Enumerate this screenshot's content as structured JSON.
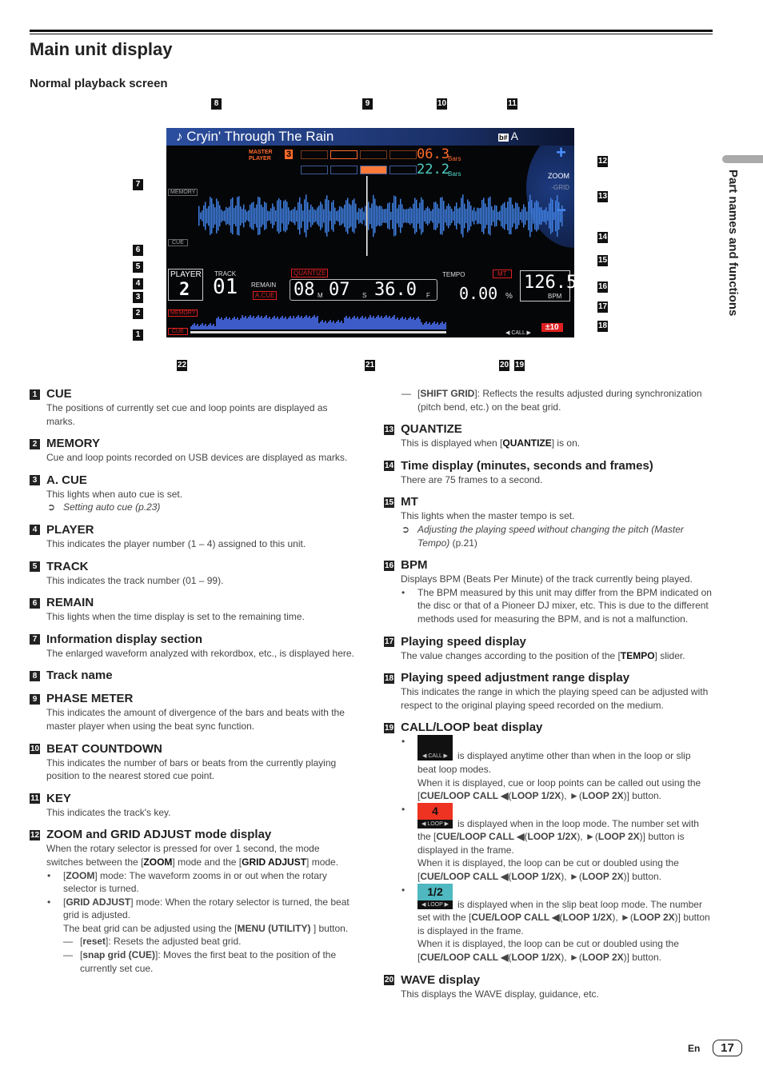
{
  "page": {
    "title": "Main unit display",
    "subtitle": "Normal playback screen",
    "side_tab": "Part names and functions",
    "lang": "En",
    "page_number": "17"
  },
  "figure": {
    "track_title": "♪ Cryin' Through The Rain",
    "key_icon": "b#",
    "key": "A",
    "master_player_label": "MASTER PLAYER",
    "master_player_num": "3",
    "bars_master": "06.3",
    "bars_own": "22.2",
    "bars_unit": "Bars",
    "zoom_label": "ZOOM",
    "grid_label": "-GRID",
    "zoom_plus": "+",
    "zoom_minus": "−",
    "memory_label": "MEMORY",
    "cue_label": "CUE",
    "player_label": "PLAYER",
    "player_num": "2",
    "track_label": "TRACK",
    "track_num": "01",
    "remain_label": "REMAIN",
    "acue_label": "A.CUE",
    "quantize_label": "QUANTIZE",
    "time": {
      "min": "08",
      "m": "M",
      "sec": "07",
      "s": "S",
      "frames": "36.0",
      "f": "F"
    },
    "tempo_label": "TEMPO",
    "mt_label": "MT",
    "tempo_value": "0.00",
    "tempo_unit": "%",
    "bpm_value": "126.5",
    "bpm_label": "BPM",
    "range_value": "±10",
    "call_label": "◀ CALL ▶",
    "callouts": [
      "1",
      "2",
      "3",
      "4",
      "5",
      "6",
      "7",
      "8",
      "9",
      "10",
      "11",
      "12",
      "13",
      "14",
      "15",
      "16",
      "17",
      "18",
      "19",
      "20",
      "21",
      "22"
    ],
    "colors": {
      "waveform": "#3f7fe0",
      "master": "#ff6a2a",
      "own": "#4fd1c5",
      "accent_red": "#e02020"
    }
  },
  "left": [
    {
      "n": "1",
      "h": "CUE",
      "body": [
        [
          [
            "The positions of currently set cue and loop points are displayed as marks.",
            ""
          ]
        ]
      ]
    },
    {
      "n": "2",
      "h": "MEMORY",
      "body": [
        [
          [
            "Cue and loop points recorded on USB devices are displayed as marks.",
            ""
          ]
        ]
      ]
    },
    {
      "n": "3",
      "h": "A. CUE",
      "body": [
        [
          [
            "This lights when auto cue is set.",
            ""
          ]
        ]
      ],
      "items": [
        {
          "mk": "➲",
          "t": [
            [
              "Setting auto cue",
              "i"
            ],
            [
              " (p.23)",
              "i"
            ]
          ]
        }
      ]
    },
    {
      "n": "4",
      "h": "PLAYER",
      "body": [
        [
          [
            "This indicates the player number (1 – 4) assigned to this unit.",
            ""
          ]
        ]
      ]
    },
    {
      "n": "5",
      "h": "TRACK",
      "body": [
        [
          [
            "This indicates the track number (01 – 99).",
            ""
          ]
        ]
      ]
    },
    {
      "n": "6",
      "h": "REMAIN",
      "body": [
        [
          [
            "This lights when the time display is set to the remaining time.",
            ""
          ]
        ]
      ]
    },
    {
      "n": "7",
      "h": "Information display section",
      "body": [
        [
          [
            "The enlarged waveform analyzed with rekordbox, etc., is displayed here.",
            ""
          ]
        ]
      ]
    },
    {
      "n": "8",
      "h": "Track name"
    },
    {
      "n": "9",
      "h": "PHASE METER",
      "body": [
        [
          [
            "This indicates the amount of divergence of the bars and beats with the master player when using the beat sync function.",
            ""
          ]
        ]
      ]
    },
    {
      "n": "10",
      "h": "BEAT COUNTDOWN",
      "body": [
        [
          [
            "This indicates the number of bars or beats from the currently playing position to the nearest stored cue point.",
            ""
          ]
        ]
      ]
    },
    {
      "n": "11",
      "h": "KEY",
      "body": [
        [
          [
            "This indicates the track's key.",
            ""
          ]
        ]
      ]
    },
    {
      "n": "12",
      "h": "ZOOM and GRID ADJUST mode display",
      "body": [
        [
          [
            "When the rotary selector is pressed for over 1 second, the mode switches between the [",
            ""
          ],
          [
            "ZOOM",
            "b"
          ],
          [
            "] mode and the [",
            ""
          ],
          [
            "GRID ADJUST",
            "b"
          ],
          [
            "] mode.",
            ""
          ]
        ]
      ],
      "items": [
        {
          "mk": "•",
          "t": [
            [
              "[",
              ""
            ],
            [
              "ZOOM",
              "b"
            ],
            [
              "] mode: The waveform zooms in or out when the rotary selector is turned.",
              ""
            ]
          ]
        },
        {
          "mk": "•",
          "t": [
            [
              "[",
              ""
            ],
            [
              "GRID ADJUST",
              "b"
            ],
            [
              "] mode: When the rotary selector is turned, the beat grid is adjusted.",
              ""
            ]
          ]
        },
        {
          "mk": "",
          "t": [
            [
              "The beat grid can be adjusted using the [",
              ""
            ],
            [
              "MENU (UTILITY)",
              "b"
            ],
            [
              " ] button.",
              ""
            ]
          ]
        },
        {
          "mk": "—",
          "t": [
            [
              "[",
              ""
            ],
            [
              "reset",
              "b"
            ],
            [
              "]: Resets the adjusted beat grid.",
              ""
            ]
          ]
        },
        {
          "mk": "—",
          "t": [
            [
              "[",
              ""
            ],
            [
              "snap grid (CUE)",
              "b"
            ],
            [
              "]: Moves the first beat to the position of the currently set cue.",
              ""
            ]
          ]
        }
      ]
    }
  ],
  "right": [
    {
      "items": [
        {
          "mk": "—",
          "t": [
            [
              "[",
              ""
            ],
            [
              "SHIFT GRID",
              "b"
            ],
            [
              "]: Reflects the results adjusted during synchronization (pitch bend, etc.) on the beat grid.",
              ""
            ]
          ]
        }
      ]
    },
    {
      "n": "13",
      "h": "QUANTIZE",
      "body": [
        [
          [
            "This is displayed when [",
            ""
          ],
          [
            "QUANTIZE",
            "b"
          ],
          [
            "] is on.",
            ""
          ]
        ]
      ]
    },
    {
      "n": "14",
      "h": "Time display (minutes, seconds and frames)",
      "body": [
        [
          [
            "There are 75 frames to a second.",
            ""
          ]
        ]
      ]
    },
    {
      "n": "15",
      "h": "MT",
      "body": [
        [
          [
            "This lights when the master tempo is set.",
            ""
          ]
        ]
      ],
      "items": [
        {
          "mk": "➲",
          "t": [
            [
              "Adjusting the playing speed without changing the pitch (Master Tempo)",
              "i"
            ],
            [
              " (p.21)",
              ""
            ]
          ]
        }
      ]
    },
    {
      "n": "16",
      "h": "BPM",
      "body": [
        [
          [
            "Displays BPM (Beats Per Minute) of the track currently being played.",
            ""
          ]
        ]
      ],
      "items": [
        {
          "mk": "•",
          "t": [
            [
              "The BPM measured by this unit may differ from the BPM indicated on the disc or that of a Pioneer DJ mixer, etc. This is due to the different methods used for measuring the BPM, and is not a malfunction.",
              ""
            ]
          ]
        }
      ]
    },
    {
      "n": "17",
      "h": "Playing speed display",
      "body": [
        [
          [
            "The value changes according to the position of the [",
            ""
          ],
          [
            "TEMPO",
            "b"
          ],
          [
            "] slider.",
            ""
          ]
        ]
      ]
    },
    {
      "n": "18",
      "h": "Playing speed adjustment range display",
      "body": [
        [
          [
            "This indicates the range in which the playing speed can be adjusted with respect to the original playing speed recorded on the medium.",
            ""
          ]
        ]
      ]
    },
    {
      "n": "19",
      "h": "CALL/LOOP beat display",
      "items": [
        {
          "mk": "•",
          "icon": {
            "top": "",
            "bot": "◀ CALL ▶",
            "color": "#111"
          },
          "t": [
            [
              "is displayed anytime other than when in the loop or slip beat loop modes.",
              ""
            ]
          ]
        },
        {
          "mk": "",
          "t": [
            [
              "When it is displayed, cue or loop points can be called out using the [",
              ""
            ],
            [
              "CUE/LOOP CALL ◀",
              "b"
            ],
            [
              "(",
              ""
            ],
            [
              "LOOP 1/2X",
              "b"
            ],
            [
              "), ►(",
              ""
            ],
            [
              "LOOP 2X",
              "b"
            ],
            [
              ")] button.",
              ""
            ]
          ]
        },
        {
          "mk": "•",
          "icon": {
            "top": "4",
            "bot": "◀ LOOP ▶",
            "color": "#ee3322"
          },
          "t": [
            [
              "is displayed when in the loop mode. The number set with the [",
              ""
            ],
            [
              "CUE/LOOP  CALL  ◀",
              "b"
            ],
            [
              "(",
              ""
            ],
            [
              "LOOP 1/2X",
              "b"
            ],
            [
              "), ►(",
              ""
            ],
            [
              "LOOP 2X",
              "b"
            ],
            [
              ")] button is displayed in the frame.",
              ""
            ]
          ]
        },
        {
          "mk": "",
          "t": [
            [
              "When it is displayed, the loop can be cut or doubled using the [",
              ""
            ],
            [
              "CUE/LOOP CALL ◀",
              "b"
            ],
            [
              "(",
              ""
            ],
            [
              "LOOP 1/2X",
              "b"
            ],
            [
              "), ►(",
              ""
            ],
            [
              "LOOP 2X",
              "b"
            ],
            [
              ")] button.",
              ""
            ]
          ]
        },
        {
          "mk": "•",
          "icon": {
            "top": "1/2",
            "bot": "◀ LOOP ▶",
            "color": "#4fb8c0"
          },
          "t": [
            [
              "is displayed when in the slip beat loop mode. The number set with the [",
              ""
            ],
            [
              "CUE/LOOP  CALL  ◀",
              "b"
            ],
            [
              "(",
              ""
            ],
            [
              "LOOP 1/2X",
              "b"
            ],
            [
              "), ►(",
              ""
            ],
            [
              "LOOP 2X",
              "b"
            ],
            [
              ")] button is displayed in the frame.",
              ""
            ]
          ]
        },
        {
          "mk": "",
          "t": [
            [
              "When it is displayed, the loop can be cut or doubled using the [",
              ""
            ],
            [
              "CUE/LOOP CALL ◀",
              "b"
            ],
            [
              "(",
              ""
            ],
            [
              "LOOP 1/2X",
              "b"
            ],
            [
              "), ►(",
              ""
            ],
            [
              "LOOP 2X",
              "b"
            ],
            [
              ")] button.",
              ""
            ]
          ]
        }
      ]
    },
    {
      "n": "20",
      "h": "WAVE display",
      "body": [
        [
          [
            "This displays the WAVE display, guidance, etc.",
            ""
          ]
        ]
      ]
    }
  ]
}
